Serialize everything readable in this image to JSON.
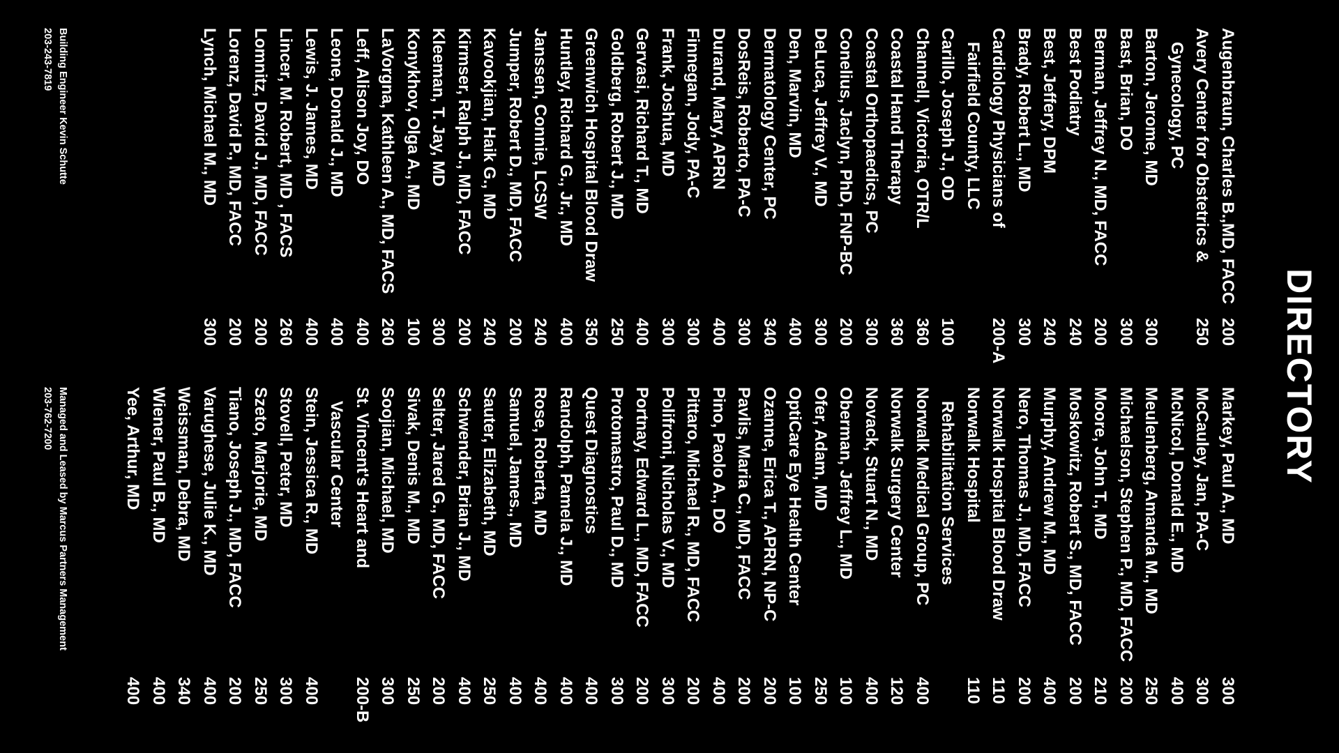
{
  "title": "DIRECTORY",
  "directory_left": [
    {
      "name": "Augenbraun, Charles B.,MD, FACC",
      "suite": "200"
    },
    {
      "name": "Avery Center for Obstetrics &",
      "suite": "250"
    },
    {
      "name": "   Gynecology, PC",
      "suite": ""
    },
    {
      "name": "Barton, Jerome, MD",
      "suite": "300"
    },
    {
      "name": "Bast, Brian, DO",
      "suite": "300"
    },
    {
      "name": "Berman, Jeffrey N., MD, FACC",
      "suite": "200"
    },
    {
      "name": "Best Podiatry",
      "suite": "240"
    },
    {
      "name": "Best, Jeffery, DPM",
      "suite": "240"
    },
    {
      "name": "Brady, Robert L., MD",
      "suite": "300"
    },
    {
      "name": "Cardiology Physicians of",
      "suite": "200-A"
    },
    {
      "name": "   Fairfield County, LLC",
      "suite": ""
    },
    {
      "name": "Carillo, Joseph J., OD",
      "suite": "100"
    },
    {
      "name": "Channell, Victoria, OTR/L",
      "suite": "360"
    },
    {
      "name": "Coastal Hand Therapy",
      "suite": "360"
    },
    {
      "name": "Coastal Orthopaedics, PC",
      "suite": "300"
    },
    {
      "name": "Conelius, Jaclyn, PhD, FNP-BC",
      "suite": "200"
    },
    {
      "name": "DeLuca, Jeffrey V., MD",
      "suite": "300"
    },
    {
      "name": "Den, Marvin, MD",
      "suite": "400"
    },
    {
      "name": "Dermatology Center, PC",
      "suite": "340"
    },
    {
      "name": "DosReis, Roberto, PA-C",
      "suite": "300"
    },
    {
      "name": "Durand, Mary, APRN",
      "suite": "400"
    },
    {
      "name": "Finnegan, Jody, PA-C",
      "suite": "300"
    },
    {
      "name": "Frank, Joshua, MD",
      "suite": "300"
    },
    {
      "name": "Gervasi, Richard T., MD",
      "suite": "400"
    },
    {
      "name": "Goldberg, Robert J., MD",
      "suite": "250"
    },
    {
      "name": "Greenwich Hospital Blood Draw",
      "suite": "350"
    },
    {
      "name": "Huntley, Richard G., Jr., MD",
      "suite": "400"
    },
    {
      "name": "Janssen, Connie, LCSW",
      "suite": "240"
    },
    {
      "name": "Jumper, Robert D., MD, FACC",
      "suite": "200"
    },
    {
      "name": "Kavookjian, Haik G., MD",
      "suite": "240"
    },
    {
      "name": "Kirmser, Ralph J., MD, FACC",
      "suite": "200"
    },
    {
      "name": "Kleeman, T. Jay, MD",
      "suite": "300"
    },
    {
      "name": "Konykhov, Olga A., MD",
      "suite": "100"
    },
    {
      "name": "LaVorgna, Kathleen A., MD, FACS",
      "suite": "260"
    },
    {
      "name": "Leff, Alison Joy, DO",
      "suite": "400"
    },
    {
      "name": "Leone, Donald J., MD",
      "suite": "400"
    },
    {
      "name": "Lewis, J. James, MD",
      "suite": "400"
    },
    {
      "name": "Lincer, M. Robert, MD , FACS",
      "suite": "260"
    },
    {
      "name": "Lomnitz, David J., MD, FACC",
      "suite": "200"
    },
    {
      "name": "Lorenz, David P., MD, FACC",
      "suite": "200"
    },
    {
      "name": "Lynch, Michael M., MD",
      "suite": "300"
    }
  ],
  "directory_right": [
    {
      "name": "Markey, Paul A., MD",
      "suite": "300"
    },
    {
      "name": "McCauley, Jan, PA-C",
      "suite": "300"
    },
    {
      "name": "McNicol, Donald E., MD",
      "suite": "400"
    },
    {
      "name": "Meulenberg, Amanda M., MD",
      "suite": "250"
    },
    {
      "name": "Michaelson, Stephen P., MD, FACC",
      "suite": "200"
    },
    {
      "name": "Moore, John T., MD",
      "suite": "210"
    },
    {
      "name": "Moskowitz, Robert S., MD, FACC",
      "suite": "200"
    },
    {
      "name": "Murphy, Andrew M., MD",
      "suite": "400"
    },
    {
      "name": "Nero, Thomas J., MD, FACC",
      "suite": "200"
    },
    {
      "name": "Norwalk Hospital Blood Draw",
      "suite": "110"
    },
    {
      "name": "Norwalk Hospital",
      "suite": "110"
    },
    {
      "name": "   Rehabilitation Services",
      "suite": ""
    },
    {
      "name": "Norwalk Medical Group, PC",
      "suite": "400"
    },
    {
      "name": "Norwalk Surgery Center",
      "suite": "120"
    },
    {
      "name": "Novack, Stuart N., MD",
      "suite": "400"
    },
    {
      "name": "Oberman, Jeffrey L., MD",
      "suite": "100"
    },
    {
      "name": "Ofer, Adam, MD",
      "suite": "250"
    },
    {
      "name": "OptiCare Eye Health Center",
      "suite": "100"
    },
    {
      "name": "Ozanne, Erica T., APRN, NP-C",
      "suite": "200"
    },
    {
      "name": "Pavlis, Maria C., MD, FACC",
      "suite": "200"
    },
    {
      "name": "Pino, Paolo A., DO",
      "suite": "400"
    },
    {
      "name": "Pittaro, Michael R., MD, FACC",
      "suite": "200"
    },
    {
      "name": "Polifroni, Nicholas V., MD",
      "suite": "300"
    },
    {
      "name": "Portnay, Edward L., MD, FACC",
      "suite": "200"
    },
    {
      "name": "Protomastro, Paul D., MD",
      "suite": "300"
    },
    {
      "name": "Quest Diagnostics",
      "suite": "400"
    },
    {
      "name": "Randolph, Pamela J., MD",
      "suite": "400"
    },
    {
      "name": "Rose, Roberta, MD",
      "suite": "400"
    },
    {
      "name": "Samuel, James., MD",
      "suite": "400"
    },
    {
      "name": "Sauter, Elizabeth, MD",
      "suite": "250"
    },
    {
      "name": "Schwender, Brian J., MD",
      "suite": "400"
    },
    {
      "name": "Selter, Jared G., MD, FACC",
      "suite": "200"
    },
    {
      "name": "Sivak, Denis M., MD",
      "suite": "250"
    },
    {
      "name": "Soojian, Michael, MD",
      "suite": "300"
    },
    {
      "name": "St. Vincent's Heart and",
      "suite": "200-B"
    },
    {
      "name": "   Vascular Center",
      "suite": ""
    },
    {
      "name": "Stein, Jessica R., MD",
      "suite": "400"
    },
    {
      "name": "Stovell, Peter, MD",
      "suite": "300"
    },
    {
      "name": "Szeto, Marjorie, MD",
      "suite": "250"
    },
    {
      "name": "Tiano, Joseph J., MD, FACC",
      "suite": "200"
    },
    {
      "name": "Varughese, Julie K., MD",
      "suite": "400"
    },
    {
      "name": "Weissman, Debra, MD",
      "suite": "340"
    },
    {
      "name": "Wiener, Paul B., MD",
      "suite": "400"
    },
    {
      "name": "Yee, Arthur, MD",
      "suite": "400"
    }
  ],
  "footer_left": {
    "label": "Building Engineer Kevin Schutte",
    "phone": "203-243-7819"
  },
  "footer_right": {
    "label": "Managed and Leased by Marcus Partners Management",
    "phone": "203-762-7200"
  },
  "colors": {
    "background": "#000000",
    "text": "#ffffff"
  }
}
